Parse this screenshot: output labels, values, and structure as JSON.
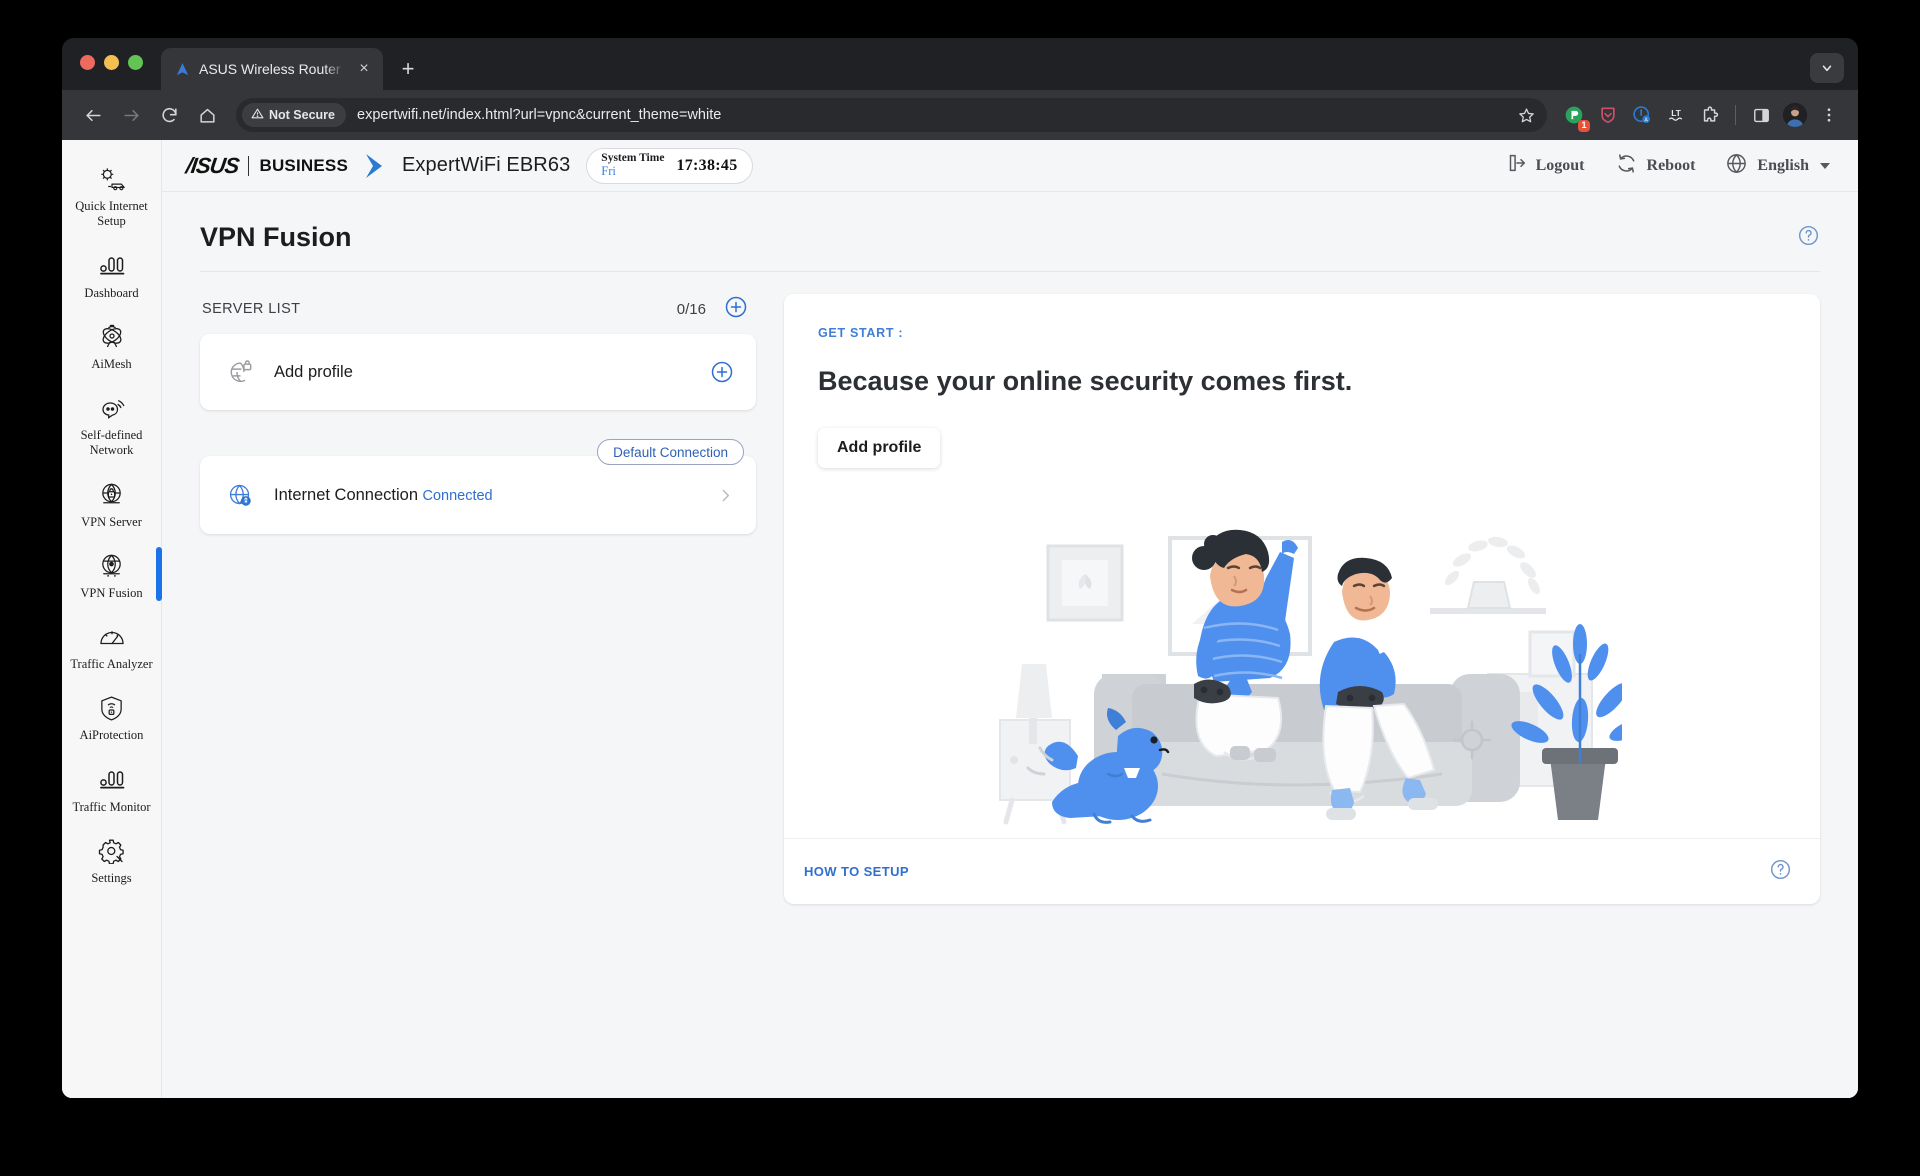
{
  "browser": {
    "tab": {
      "title": "ASUS Wireless Router Exper",
      "favicon": "asus-logo-icon",
      "close_label": "×"
    },
    "new_tab_label": "+",
    "tabstrip_overflow_icon": "chevron-down-icon",
    "nav": {
      "back_icon": "back-arrow-icon",
      "forward_icon": "forward-arrow-icon",
      "reload_icon": "reload-icon",
      "home_icon": "home-icon"
    },
    "omnibox": {
      "security_label": "Not Secure",
      "security_icon": "warning-triangle-icon",
      "url": "expertwifi.net/index.html?url=vpnc&current_theme=white",
      "bookmark_icon": "star-icon"
    },
    "extensions": [
      {
        "name": "grammar-extension-icon",
        "badge": "1",
        "color": "#2aa25b"
      },
      {
        "name": "shield-extension-icon",
        "color": "#cf4e68"
      },
      {
        "name": "privacy-extension-icon",
        "color": "#2a7ad4"
      },
      {
        "name": "language-tool-extension-icon",
        "color": "#e8eaed"
      },
      {
        "name": "puzzle-extensions-icon",
        "color": "#d3d5d8"
      },
      {
        "name": "side-panel-icon",
        "color": "#d3d5d8"
      },
      {
        "name": "profile-avatar-icon",
        "color": "#d3d5d8"
      },
      {
        "name": "chrome-menu-icon",
        "color": "#d3d5d8"
      }
    ]
  },
  "sidebar": {
    "items": [
      {
        "label": "Quick Internet Setup",
        "icon": "quick-internet-setup-icon",
        "active": false
      },
      {
        "label": "Dashboard",
        "icon": "dashboard-bars-icon",
        "active": false
      },
      {
        "label": "AiMesh",
        "icon": "aimesh-icon",
        "active": false
      },
      {
        "label": "Self-defined Network",
        "icon": "self-defined-network-icon",
        "active": false
      },
      {
        "label": "VPN Server",
        "icon": "vpn-server-icon",
        "active": false
      },
      {
        "label": "VPN Fusion",
        "icon": "vpn-fusion-icon",
        "active": true
      },
      {
        "label": "Traffic Analyzer",
        "icon": "traffic-analyzer-icon",
        "active": false
      },
      {
        "label": "AiProtection",
        "icon": "aiprotection-shield-icon",
        "active": false
      },
      {
        "label": "Traffic Monitor",
        "icon": "traffic-monitor-icon",
        "active": false
      },
      {
        "label": "Settings",
        "icon": "settings-gear-icon",
        "active": false
      }
    ]
  },
  "header": {
    "brand_asus": "/ISUS",
    "brand_business": "BUSINESS",
    "model": "ExpertWiFi EBR63",
    "system_time": {
      "label": "System Time",
      "day": "Fri",
      "clock": "17:38:45"
    },
    "actions": [
      {
        "label": "Logout",
        "icon": "logout-icon"
      },
      {
        "label": "Reboot",
        "icon": "reboot-icon"
      },
      {
        "label": "English",
        "icon": "globe-icon",
        "has_caret": true
      }
    ]
  },
  "main": {
    "page_title": "VPN Fusion",
    "help_icon": "help-circle-icon",
    "server_list": {
      "title": "SERVER LIST",
      "count": "0/16",
      "add_icon": "plus-circle-icon"
    },
    "cards": [
      {
        "title": "Add profile",
        "icon": "globe-lock-icon",
        "action_icon": "plus-circle-icon",
        "has_skeleton": true
      },
      {
        "title": "Internet Connection",
        "subtitle": "Connected",
        "icon": "globe-connected-icon",
        "badge": "Default Connection",
        "action_icon": "chevron-right-icon"
      }
    ],
    "promo": {
      "kicker": "GET START :",
      "heading": "Because your online security comes first.",
      "cta": "Add profile",
      "illustration": "people-gaming-on-couch-illustration",
      "footer_link": "HOW TO SETUP",
      "footer_help_icon": "help-circle-icon"
    }
  },
  "colors": {
    "accent_blue": "#1a73e8",
    "link_blue": "#2f6fd0",
    "page_bg": "#f5f6f7",
    "card_bg": "#ffffff",
    "chrome_dark": "#35363a"
  }
}
